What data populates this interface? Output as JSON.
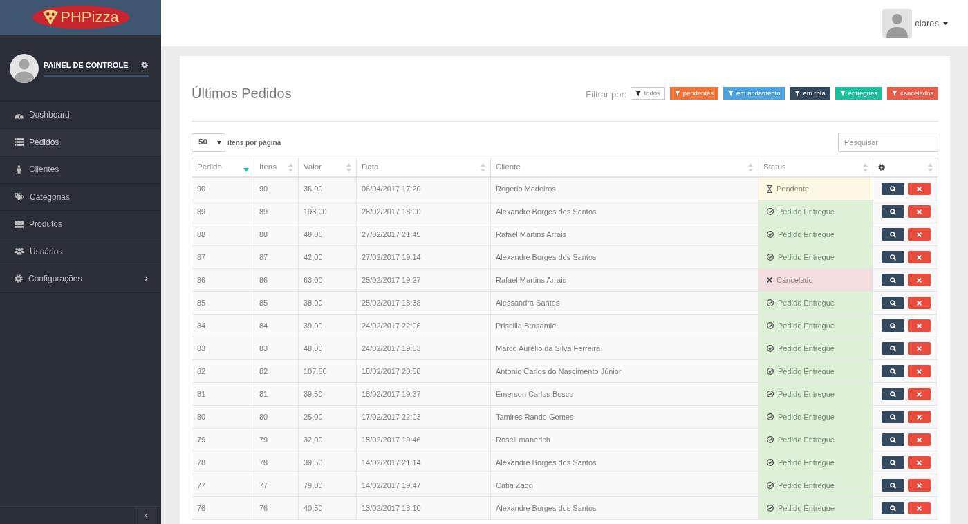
{
  "sidebar": {
    "brand": "PHPizza",
    "profile_title": "PAINEL DE CONTROLE",
    "items": [
      {
        "label": "Dashboard",
        "selected": false,
        "submenu": false
      },
      {
        "label": "Pedidos",
        "selected": true,
        "submenu": false
      },
      {
        "label": "Clientes",
        "selected": false,
        "submenu": false
      },
      {
        "label": "Categorias",
        "selected": false,
        "submenu": false
      },
      {
        "label": "Produtos",
        "selected": false,
        "submenu": false
      },
      {
        "label": "Usuários",
        "selected": false,
        "submenu": false
      },
      {
        "label": "Configurações",
        "selected": false,
        "submenu": true
      }
    ]
  },
  "header": {
    "user_name": "clares"
  },
  "content": {
    "title": "Últimos Pedidos",
    "filter_label": "Filtrar por:",
    "filters": [
      {
        "label": "todos",
        "kind": "default"
      },
      {
        "label": "pendentes",
        "kind": "solid",
        "color": "#f0733a"
      },
      {
        "label": "em andamento",
        "kind": "solid",
        "color": "#4da2e0"
      },
      {
        "label": "em rota",
        "kind": "solid",
        "color": "#34495e"
      },
      {
        "label": "entregues",
        "kind": "solid",
        "color": "#1dbf9c"
      },
      {
        "label": "cancelados",
        "kind": "solid",
        "color": "#e85c4a"
      }
    ],
    "page_size": {
      "value": "50",
      "label": "itens por página"
    },
    "search": {
      "placeholder": "Pesquisar"
    }
  },
  "table": {
    "columns": [
      {
        "kind": "text",
        "label": "Pedido",
        "sorted": true
      },
      {
        "kind": "text",
        "label": "Itens",
        "sorted": false
      },
      {
        "kind": "text",
        "label": "Valor",
        "sorted": false
      },
      {
        "kind": "text",
        "label": "Data",
        "sorted": false
      },
      {
        "kind": "text",
        "label": "Cliente",
        "sorted": false
      },
      {
        "kind": "text",
        "label": "Status",
        "sorted": false
      },
      {
        "kind": "actions",
        "sorted": false
      }
    ],
    "rows": [
      {
        "cells": [
          "90",
          "90",
          "36,00",
          "06/04/2017 17:20",
          "Rogerio Medeiros"
        ],
        "status": {
          "kind": "pending",
          "label": "Pendente"
        }
      },
      {
        "cells": [
          "89",
          "89",
          "198,00",
          "28/02/2017 18:00",
          "Alexandre Borges dos Santos"
        ],
        "status": {
          "kind": "delivered",
          "label": "Pedido Entregue"
        }
      },
      {
        "cells": [
          "88",
          "88",
          "48,00",
          "27/02/2017 21:45",
          "Rafael Martins Arrais"
        ],
        "status": {
          "kind": "delivered",
          "label": "Pedido Entregue"
        }
      },
      {
        "cells": [
          "87",
          "87",
          "42,00",
          "27/02/2017 19:14",
          "Alexandre Borges dos Santos"
        ],
        "status": {
          "kind": "delivered",
          "label": "Pedido Entregue"
        }
      },
      {
        "cells": [
          "86",
          "86",
          "63,00",
          "25/02/2017 19:27",
          "Rafael Martins Arrais"
        ],
        "status": {
          "kind": "cancelled",
          "label": "Cancelado"
        }
      },
      {
        "cells": [
          "85",
          "85",
          "38,00",
          "25/02/2017 18:38",
          "Alessandra Santos"
        ],
        "status": {
          "kind": "delivered",
          "label": "Pedido Entregue"
        }
      },
      {
        "cells": [
          "84",
          "84",
          "39,00",
          "24/02/2017 22:06",
          "Priscilla Brosamle"
        ],
        "status": {
          "kind": "delivered",
          "label": "Pedido Entregue"
        }
      },
      {
        "cells": [
          "83",
          "83",
          "48,00",
          "24/02/2017 19:53",
          "Marco Aurélio da Silva Ferreira"
        ],
        "status": {
          "kind": "delivered",
          "label": "Pedido Entregue"
        }
      },
      {
        "cells": [
          "82",
          "82",
          "107,50",
          "18/02/2017 20:58",
          "Antonio Carlos do Nascimento Júnior"
        ],
        "status": {
          "kind": "delivered",
          "label": "Pedido Entregue"
        }
      },
      {
        "cells": [
          "81",
          "81",
          "39,50",
          "18/02/2017 19:37",
          "Emerson Carlos Bosco"
        ],
        "status": {
          "kind": "delivered",
          "label": "Pedido Entregue"
        }
      },
      {
        "cells": [
          "80",
          "80",
          "25,00",
          "17/02/2017 22:03",
          "Tamires Rando Gomes"
        ],
        "status": {
          "kind": "delivered",
          "label": "Pedido Entregue"
        }
      },
      {
        "cells": [
          "79",
          "79",
          "32,00",
          "15/02/2017 19:46",
          "Roseli manerich"
        ],
        "status": {
          "kind": "delivered",
          "label": "Pedido Entregue"
        }
      },
      {
        "cells": [
          "78",
          "78",
          "39,50",
          "14/02/2017 21:14",
          "Alexandre Borges dos Santos"
        ],
        "status": {
          "kind": "delivered",
          "label": "Pedido Entregue"
        }
      },
      {
        "cells": [
          "77",
          "77",
          "79,00",
          "14/02/2017 19:47",
          "Cátia Zago"
        ],
        "status": {
          "kind": "delivered",
          "label": "Pedido Entregue"
        }
      },
      {
        "cells": [
          "76",
          "76",
          "40,50",
          "13/02/2017 18:10",
          "Alexandre Borges dos Santos"
        ],
        "status": {
          "kind": "delivered",
          "label": "Pedido Entregue"
        }
      }
    ]
  }
}
